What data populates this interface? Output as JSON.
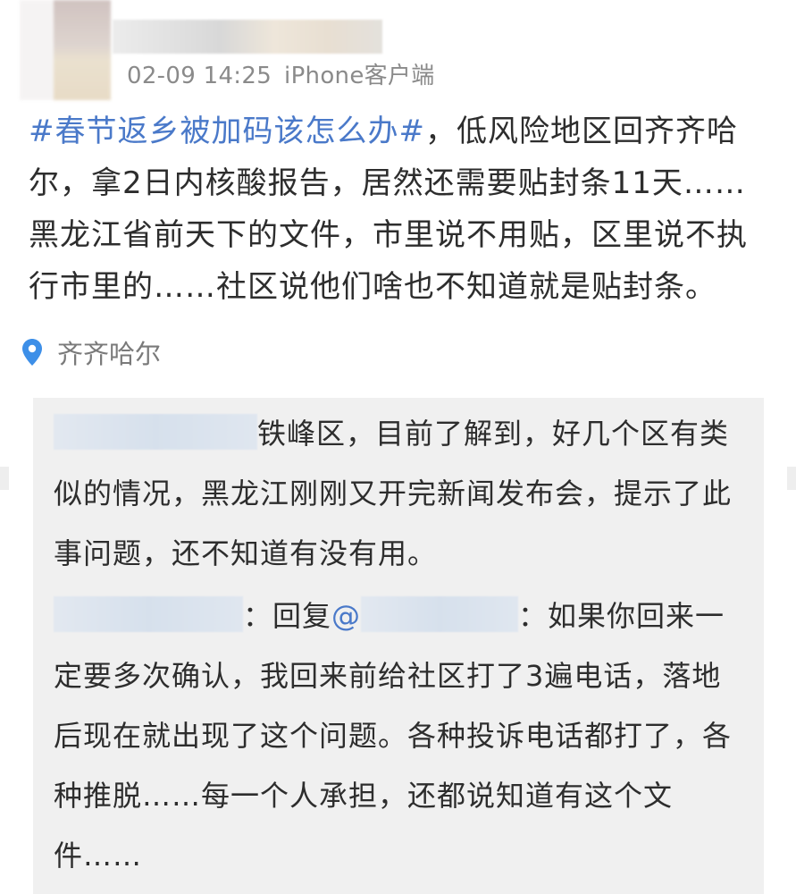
{
  "post": {
    "timestamp": "02-09 14:25",
    "client": "iPhone客户端",
    "hashtag": "#春节返乡被加码该怎么办#",
    "text": "，低风险地区回齐齐哈尔，拿2日内核酸报告，居然还需要贴封条11天……黑龙江省前天下的文件，市里说不用贴，区里说不执行市里的……社区说他们啥也不知道就是贴封条。",
    "location": "齐齐哈尔"
  },
  "comments": {
    "first": {
      "text": "铁峰区，目前了解到，好几个区有类似的情况，黑龙江刚刚又开完新闻发布会，提示了此事问题，还不知道有没有用。"
    },
    "second": {
      "name_suffix": "：",
      "reply_prefix": "回复",
      "mention_at": "@",
      "mention_suffix": "：",
      "text": "如果你回来一定要多次确认，我回来前给社区打了3遍电话，落地后现在就出现了这个问题。各种投诉电话都打了，各种推脱……每一个人承担，还都说知道有这个文件……"
    }
  },
  "colors": {
    "link": "#4a79c9",
    "meta": "#8a8a8a",
    "comment_bg": "#f0f0f0",
    "location_pin": "#3d8fe8"
  },
  "icons": {
    "location": "location-pin-icon"
  }
}
